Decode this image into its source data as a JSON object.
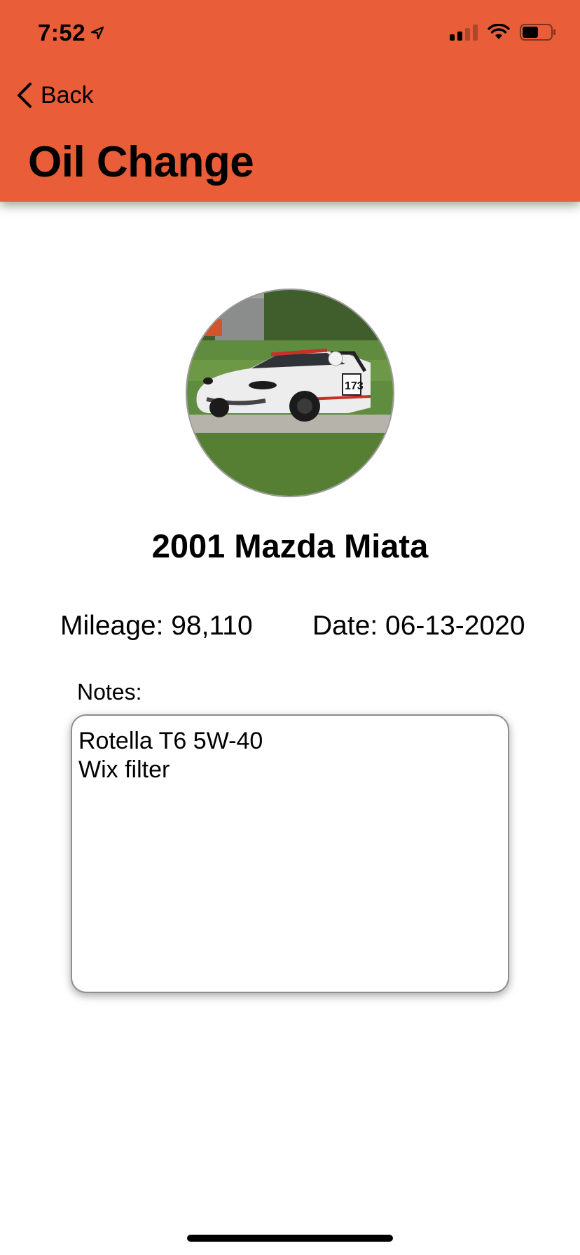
{
  "status_bar": {
    "time": "7:52",
    "location_icon": "location-arrow-icon",
    "signal_icon": "cellular-signal-icon",
    "wifi_icon": "wifi-icon",
    "battery_icon": "battery-icon"
  },
  "nav": {
    "back_label": "Back",
    "back_icon": "chevron-left-icon",
    "title": "Oil Change"
  },
  "colors": {
    "header_bg": "#E95E38"
  },
  "vehicle": {
    "photo": "car-photo",
    "name": "2001 Mazda Miata"
  },
  "details": {
    "mileage_text": "Mileage: 98,110",
    "date_text": "Date: 06-13-2020"
  },
  "notes": {
    "label": "Notes:",
    "lines": [
      "Rotella T6 5W-40",
      "Wix filter"
    ]
  }
}
